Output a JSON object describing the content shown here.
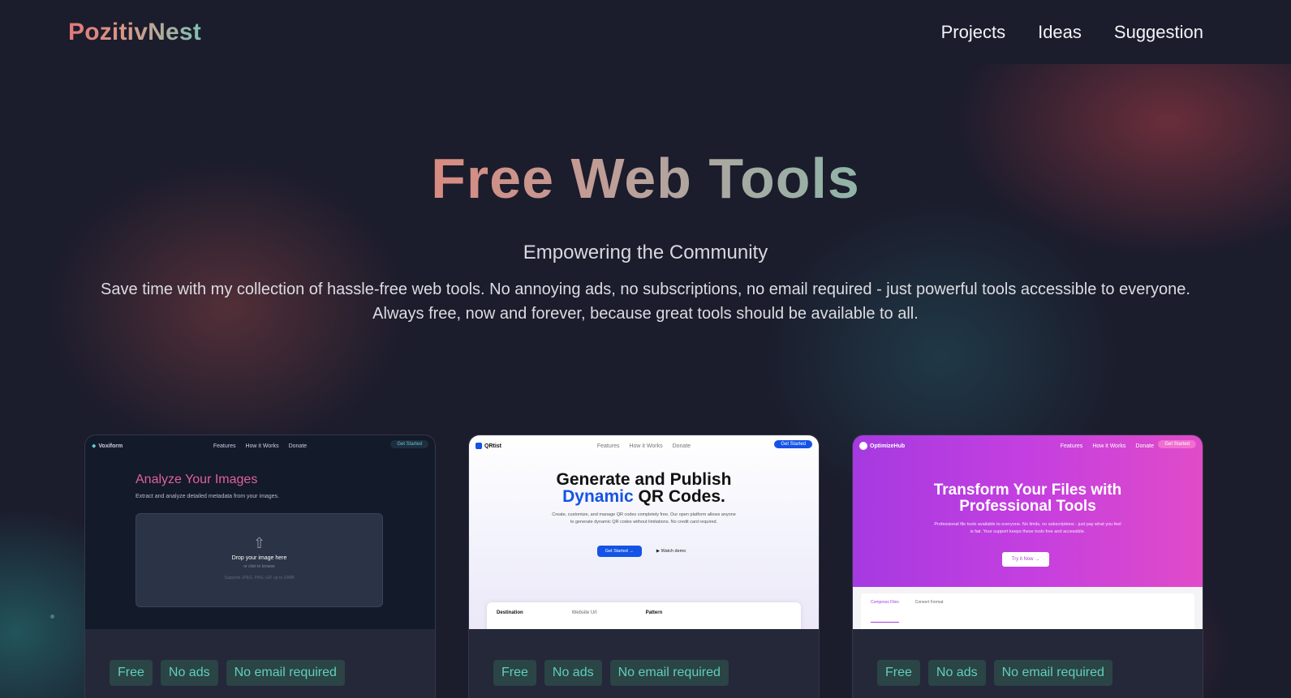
{
  "header": {
    "logo": "PozitivNest",
    "nav": [
      {
        "label": "Projects"
      },
      {
        "label": "Ideas"
      },
      {
        "label": "Suggestion"
      }
    ]
  },
  "hero": {
    "title": "Free Web Tools",
    "subtitle": "Empowering the Community",
    "description": "Save time with my collection of hassle-free web tools. No annoying ads, no subscriptions, no email required - just powerful tools accessible to everyone. Always free, now and forever, because great tools should be available to all."
  },
  "cards": [
    {
      "preview": {
        "brand": "Voxiform",
        "links": [
          "Features",
          "How it Works",
          "Donate"
        ],
        "cta": "Get Started",
        "headline": "Analyze Your Images",
        "sub": "Extract and analyze detailed metadata from your images.",
        "drop_title": "Drop your image here",
        "drop_sub": "or click to browse",
        "drop_note": "Supports JPEG, PNG, GIF up to 10MB"
      },
      "tags": [
        "Free",
        "No ads",
        "No email required"
      ]
    },
    {
      "preview": {
        "brand": "QRtist",
        "links": [
          "Features",
          "How it Works",
          "Donate"
        ],
        "cta": "Get Started",
        "headline_a": "Generate and Publish",
        "headline_b": "Dynamic",
        "headline_c": "QR Codes.",
        "desc": "Create, customize, and manage QR codes completely free. Our open platform allows anyone to generate dynamic QR codes without limitations. No credit card required.",
        "btn_primary": "Get Started →",
        "btn_secondary": "▶ Watch demo",
        "panel_a": "Destination",
        "panel_b": "Website Url",
        "panel_c": "Pattern"
      },
      "tags": [
        "Free",
        "No ads",
        "No email required"
      ]
    },
    {
      "preview": {
        "brand": "OptimizeHub",
        "links": [
          "Features",
          "How it Works",
          "Donate"
        ],
        "cta": "Get Started",
        "headline_a": "Transform Your Files with",
        "headline_b": "Professional Tools",
        "desc": "Professional file tools available to everyone. No limits, no subscriptions - just pay what you feel is fair. Your support keeps these tools free and accessible.",
        "btn": "Try it Now →",
        "tab_a": "Compress Files",
        "tab_b": "Convert Format"
      },
      "tags": [
        "Free",
        "No ads",
        "No email required"
      ]
    }
  ]
}
